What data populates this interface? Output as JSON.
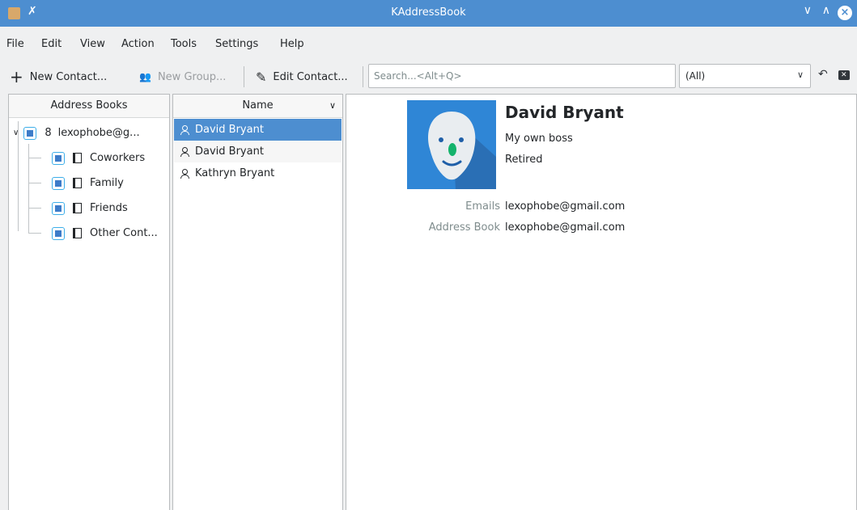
{
  "window": {
    "title": "KAddressBook"
  },
  "menu": [
    "File",
    "Edit",
    "View",
    "Action",
    "Tools",
    "Settings",
    "Help"
  ],
  "toolbar": {
    "new_contact": "New Contact...",
    "new_group": "New Group...",
    "edit_contact": "Edit Contact...",
    "search_placeholder": "Search...<Alt+Q>",
    "filter_value": "(All)"
  },
  "address_books": {
    "header": "Address Books",
    "root": "lexophobe@g...",
    "children": [
      "Coworkers",
      "Family",
      "Friends",
      "Other Cont..."
    ]
  },
  "contacts": {
    "header": "Name",
    "items": [
      "David Bryant",
      "David Bryant",
      "Kathryn Bryant"
    ]
  },
  "detail": {
    "name": "David Bryant",
    "title_line1": "My own boss",
    "title_line2": "Retired",
    "emails_label": "Emails",
    "emails_value": "lexophobe@gmail.com",
    "book_label": "Address Book",
    "book_value": "lexophobe@gmail.com"
  }
}
